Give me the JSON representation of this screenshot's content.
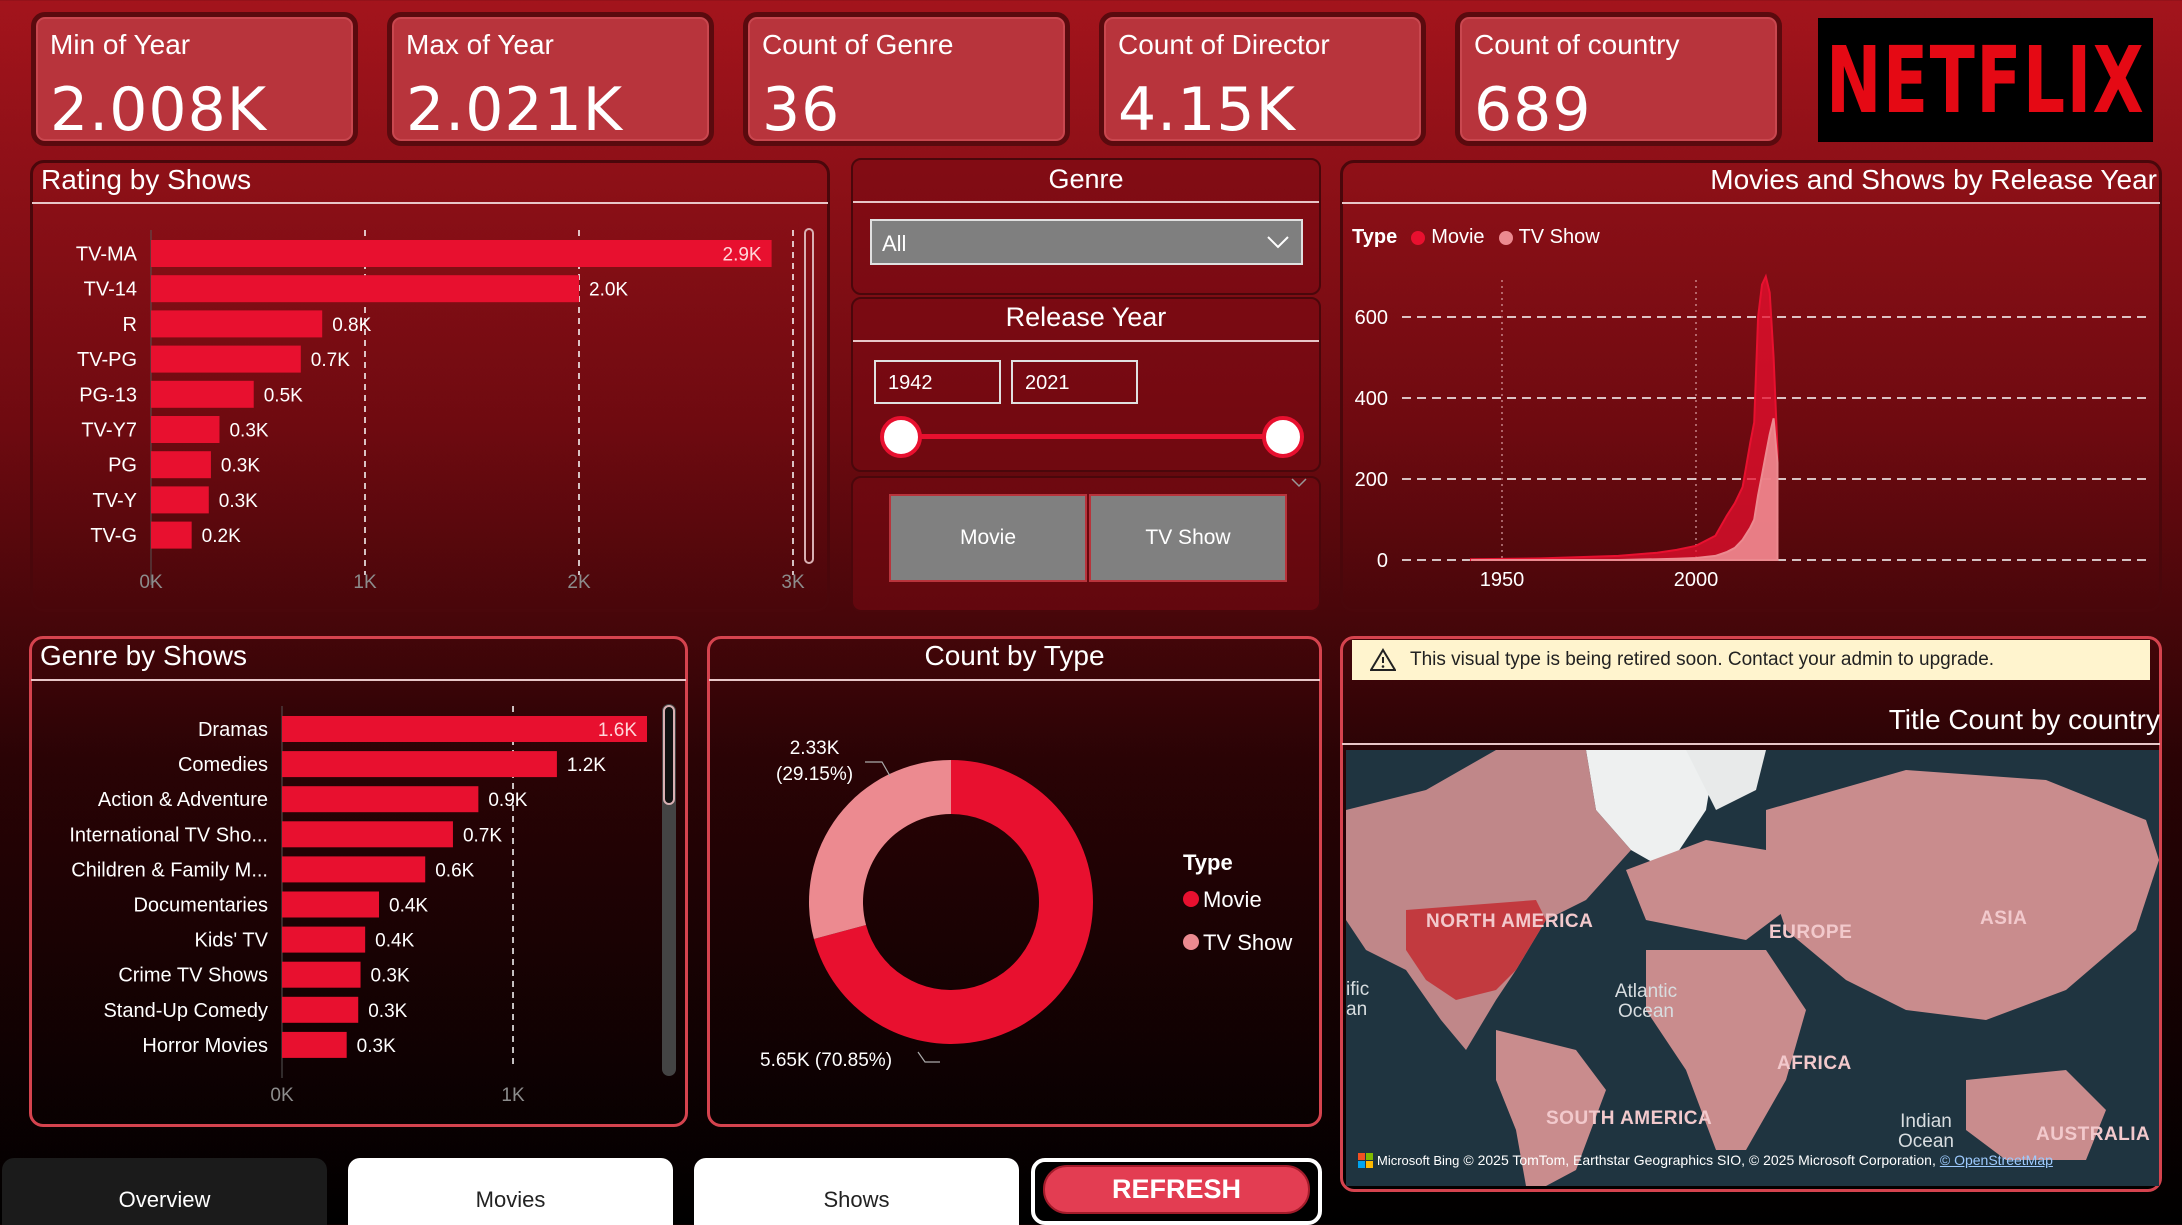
{
  "kpis": [
    {
      "label": "Min of Year",
      "value": "2.008K"
    },
    {
      "label": "Max of Year",
      "value": "2.021K"
    },
    {
      "label": "Count of Genre",
      "value": "36"
    },
    {
      "label": "Count of Director",
      "value": "4.15K"
    },
    {
      "label": "Count of country",
      "value": "689"
    }
  ],
  "logo": "NETFLIX",
  "colors": {
    "accent": "#e8102f",
    "tvshow": "#ec8a90",
    "banner": "#fff4ce"
  },
  "rating_panel": {
    "title": "Rating by Shows"
  },
  "genre_panel": {
    "title": "Genre by Shows"
  },
  "genre_slicer": {
    "title": "Genre",
    "value": "All"
  },
  "year_slicer": {
    "title": "Release Year",
    "from": "1942",
    "to": "2021"
  },
  "type_buttons": {
    "movie": "Movie",
    "tvshow": "TV Show"
  },
  "release_panel": {
    "title": "Movies and Shows by Release Year",
    "legend_title": "Type",
    "legend_movie": "Movie",
    "legend_tv": "TV Show"
  },
  "type_panel": {
    "title": "Count by Type",
    "legend_title": "Type",
    "legend_movie": "Movie",
    "legend_tv": "TV Show",
    "label_tv_1": "2.33K",
    "label_tv_2": "(29.15%)",
    "label_movie": "5.65K (70.85%)"
  },
  "map_panel": {
    "warning": "This visual type is being retired soon. Contact your admin to upgrade.",
    "title": "Title Count by country",
    "labels": {
      "north_america": "NORTH AMERICA",
      "europe": "EUROPE",
      "asia": "ASIA",
      "africa": "AFRICA",
      "south_america": "SOUTH AMERICA",
      "australia": "AUSTRALIA",
      "atlantic": "Atlantic Ocean",
      "indian": "Indian Ocean",
      "pacific": "ific an"
    },
    "attribution_brand": "Microsoft Bing",
    "attribution": "© 2025 TomTom, Earthstar Geographics SIO, © 2025 Microsoft Corporation,",
    "attribution_link": "© OpenStreetMap"
  },
  "tabs": {
    "overview": "Overview",
    "movies": "Movies",
    "shows": "Shows",
    "refresh": "REFRESH"
  },
  "chart_data": [
    {
      "type": "bar",
      "title": "Rating by Shows",
      "orientation": "horizontal",
      "categories": [
        "TV-MA",
        "TV-14",
        "R",
        "TV-PG",
        "PG-13",
        "TV-Y7",
        "PG",
        "TV-Y",
        "TV-G"
      ],
      "values": [
        2900,
        2000,
        800,
        700,
        480,
        320,
        280,
        270,
        190
      ],
      "value_labels": [
        "2.9K",
        "2.0K",
        "0.8K",
        "0.7K",
        "0.5K",
        "0.3K",
        "0.3K",
        "0.3K",
        "0.2K"
      ],
      "xlim": [
        0,
        3000
      ],
      "xticks": [
        "0K",
        "1K",
        "2K",
        "3K"
      ],
      "grid": true
    },
    {
      "type": "bar",
      "title": "Genre by Shows",
      "orientation": "horizontal",
      "categories": [
        "Dramas",
        "Comedies",
        "Action & Adventure",
        "International TV Sho...",
        "Children & Family M...",
        "Documentaries",
        "Kids' TV",
        "Crime TV Shows",
        "Stand-Up Comedy",
        "Horror Movies"
      ],
      "values": [
        1580,
        1190,
        850,
        740,
        620,
        420,
        360,
        340,
        330,
        280
      ],
      "value_labels": [
        "1.6K",
        "1.2K",
        "0.9K",
        "0.7K",
        "0.6K",
        "0.4K",
        "0.4K",
        "0.3K",
        "0.3K",
        "0.3K"
      ],
      "xlim": [
        0,
        1580
      ],
      "xticks": [
        "0K",
        "1K"
      ],
      "grid": true
    },
    {
      "type": "area",
      "title": "Movies and Shows by Release Year",
      "x": [
        1942,
        1960,
        1980,
        1990,
        1995,
        2000,
        2005,
        2008,
        2010,
        2012,
        2014,
        2015,
        2016,
        2017,
        2018,
        2019,
        2020,
        2021
      ],
      "series": [
        {
          "name": "Movie",
          "values": [
            2,
            4,
            10,
            18,
            25,
            35,
            60,
            110,
            140,
            180,
            290,
            340,
            600,
            680,
            700,
            660,
            500,
            270
          ]
        },
        {
          "name": "TV Show",
          "values": [
            0,
            0,
            0,
            2,
            3,
            5,
            10,
            20,
            30,
            50,
            80,
            100,
            160,
            210,
            260,
            310,
            350,
            240
          ]
        }
      ],
      "ylim": [
        0,
        700
      ],
      "yticks": [
        0,
        200,
        400,
        600
      ],
      "xticks": [
        1950,
        2000
      ],
      "grid": true,
      "legend": "top-left"
    },
    {
      "type": "pie",
      "title": "Count by Type",
      "donut": true,
      "slices": [
        {
          "name": "Movie",
          "value": 5650,
          "percent": 70.85
        },
        {
          "name": "TV Show",
          "value": 2330,
          "percent": 29.15
        }
      ],
      "legend": "right"
    }
  ]
}
